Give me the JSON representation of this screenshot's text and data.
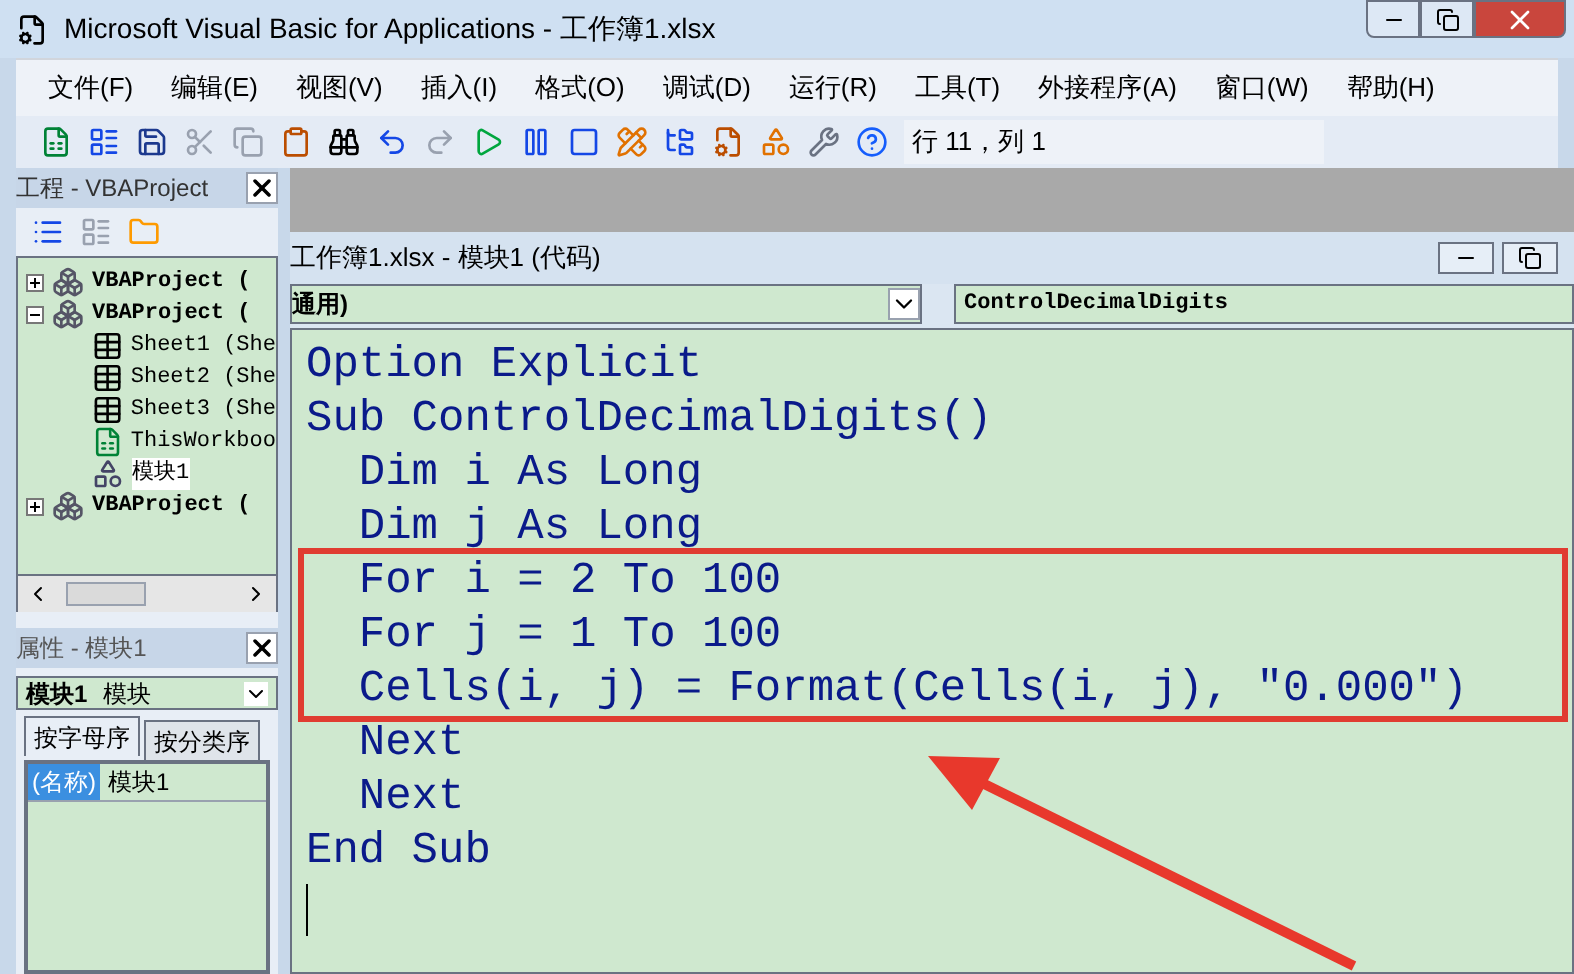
{
  "window": {
    "title": "Microsoft Visual Basic for Applications - 工作簿1.xlsx"
  },
  "menu": [
    "文件(F)",
    "编辑(E)",
    "视图(V)",
    "插入(I)",
    "格式(O)",
    "调试(D)",
    "运行(R)",
    "工具(T)",
    "外接程序(A)",
    "窗口(W)",
    "帮助(H)"
  ],
  "toolbar": {
    "position": "行 11，列 1"
  },
  "project_pane": {
    "title": "工程 - VBAProject",
    "tree": [
      {
        "label": "VBAProject (",
        "kind": "project",
        "expanded": false,
        "selected": false
      },
      {
        "label": "VBAProject (",
        "kind": "project",
        "expanded": true,
        "selected": false,
        "children": [
          {
            "label": "Sheet1 (She",
            "kind": "sheet",
            "selected": false
          },
          {
            "label": "Sheet2 (She",
            "kind": "sheet",
            "selected": false
          },
          {
            "label": "Sheet3 (She",
            "kind": "sheet",
            "selected": false
          },
          {
            "label": "ThisWorkboo",
            "kind": "workbook",
            "selected": false
          },
          {
            "label": "模块1",
            "kind": "module",
            "selected": true
          }
        ]
      },
      {
        "label": "VBAProject (",
        "kind": "project",
        "expanded": false,
        "selected": false
      }
    ]
  },
  "properties_pane": {
    "title": "属性 - 模块1",
    "object_name": "模块1",
    "object_type": "模块",
    "tabs": [
      {
        "label": "按字母序",
        "selected": true
      },
      {
        "label": "按分类序",
        "selected": false
      }
    ],
    "rows": [
      {
        "name": "(名称)",
        "value": "模块1",
        "selected": true
      }
    ]
  },
  "code_window": {
    "title": "工作簿1.xlsx - 模块1 (代码)",
    "object_dropdown": "通用)",
    "procedure_dropdown": "ControlDecimalDigits",
    "lines": [
      {
        "text": "Option Explicit",
        "highlighted": false
      },
      {
        "text": "Sub ControlDecimalDigits()",
        "highlighted": false
      },
      {
        "text": "  Dim i As Long",
        "highlighted": false
      },
      {
        "text": "  Dim j As Long",
        "highlighted": false
      },
      {
        "text": "  For i = 2 To 100",
        "highlighted": true
      },
      {
        "text": "  For j = 1 To 100",
        "highlighted": true
      },
      {
        "text": "  Cells(i, j) = Format(Cells(i, j), \"0.000\")",
        "highlighted": true
      },
      {
        "text": "  Next",
        "highlighted": false
      },
      {
        "text": "  Next",
        "highlighted": false
      },
      {
        "text": "End Sub",
        "highlighted": false
      }
    ]
  }
}
